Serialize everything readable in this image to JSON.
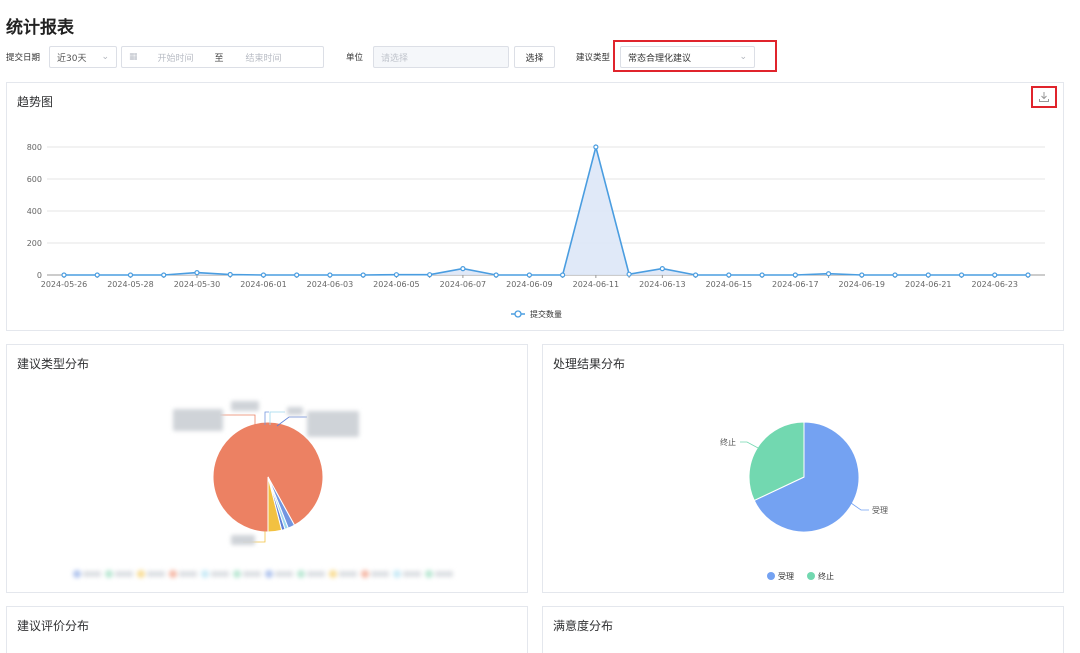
{
  "page": {
    "title": "统计报表"
  },
  "filters": {
    "date_label": "提交日期",
    "date_range_value": "近30天",
    "start_placeholder": "开始时间",
    "range_separator": "至",
    "end_placeholder": "结束时间",
    "unit_label": "单位",
    "unit_placeholder": "请选择",
    "select_button": "选择",
    "type_label": "建议类型",
    "type_value": "常态合理化建议"
  },
  "trend": {
    "title": "趋势图",
    "legend": "提交数量",
    "color": "#4a9de0",
    "chart_data": {
      "type": "area",
      "x": [
        "2024-05-26",
        "2024-05-27",
        "2024-05-28",
        "2024-05-29",
        "2024-05-30",
        "2024-05-31",
        "2024-06-01",
        "2024-06-02",
        "2024-06-03",
        "2024-06-04",
        "2024-06-05",
        "2024-06-06",
        "2024-06-07",
        "2024-06-08",
        "2024-06-09",
        "2024-06-10",
        "2024-06-11",
        "2024-06-12",
        "2024-06-13",
        "2024-06-14",
        "2024-06-15",
        "2024-06-16",
        "2024-06-17",
        "2024-06-18",
        "2024-06-19",
        "2024-06-20",
        "2024-06-21",
        "2024-06-22",
        "2024-06-23",
        "2024-06-24"
      ],
      "xticks": [
        "2024-05-26",
        "2024-05-28",
        "2024-05-30",
        "2024-06-01",
        "2024-06-03",
        "2024-06-05",
        "2024-06-07",
        "2024-06-09",
        "2024-06-11",
        "2024-06-13",
        "2024-06-15",
        "2024-06-17",
        "2024-06-19",
        "2024-06-21",
        "2024-06-23"
      ],
      "series": [
        {
          "name": "提交数量",
          "values": [
            0,
            0,
            0,
            0,
            15,
            3,
            0,
            0,
            0,
            0,
            2,
            2,
            40,
            0,
            0,
            0,
            800,
            5,
            40,
            0,
            0,
            0,
            0,
            8,
            0,
            0,
            0,
            0,
            0,
            0
          ]
        }
      ],
      "ylim": [
        0,
        800
      ],
      "yticks": [
        0,
        200,
        400,
        600,
        800
      ],
      "grid": true
    }
  },
  "type_distribution": {
    "title": "建议类型分布",
    "chart_data": {
      "type": "pie",
      "values": [
        92,
        2,
        1,
        1,
        4
      ],
      "colors": [
        "#ec8163",
        "#7396e0",
        "#9fd8ee",
        "#5e7fd6",
        "#f2c141"
      ]
    },
    "legend_colors": [
      "#7396e0",
      "#84d3b0",
      "#f2c141",
      "#ec8163",
      "#9fd8ee",
      "#84d3b0"
    ]
  },
  "result_distribution": {
    "title": "处理结果分布",
    "chart_data": {
      "type": "pie",
      "labels": [
        "受理",
        "终止"
      ],
      "values": [
        68,
        32
      ],
      "colors": [
        "#74a2f2",
        "#72d8b0"
      ]
    },
    "legend": [
      {
        "label": "受理",
        "color": "#74a2f2"
      },
      {
        "label": "终止",
        "color": "#72d8b0"
      }
    ]
  },
  "evaluation": {
    "title": "建议评价分布"
  },
  "satisfaction": {
    "title": "满意度分布"
  }
}
